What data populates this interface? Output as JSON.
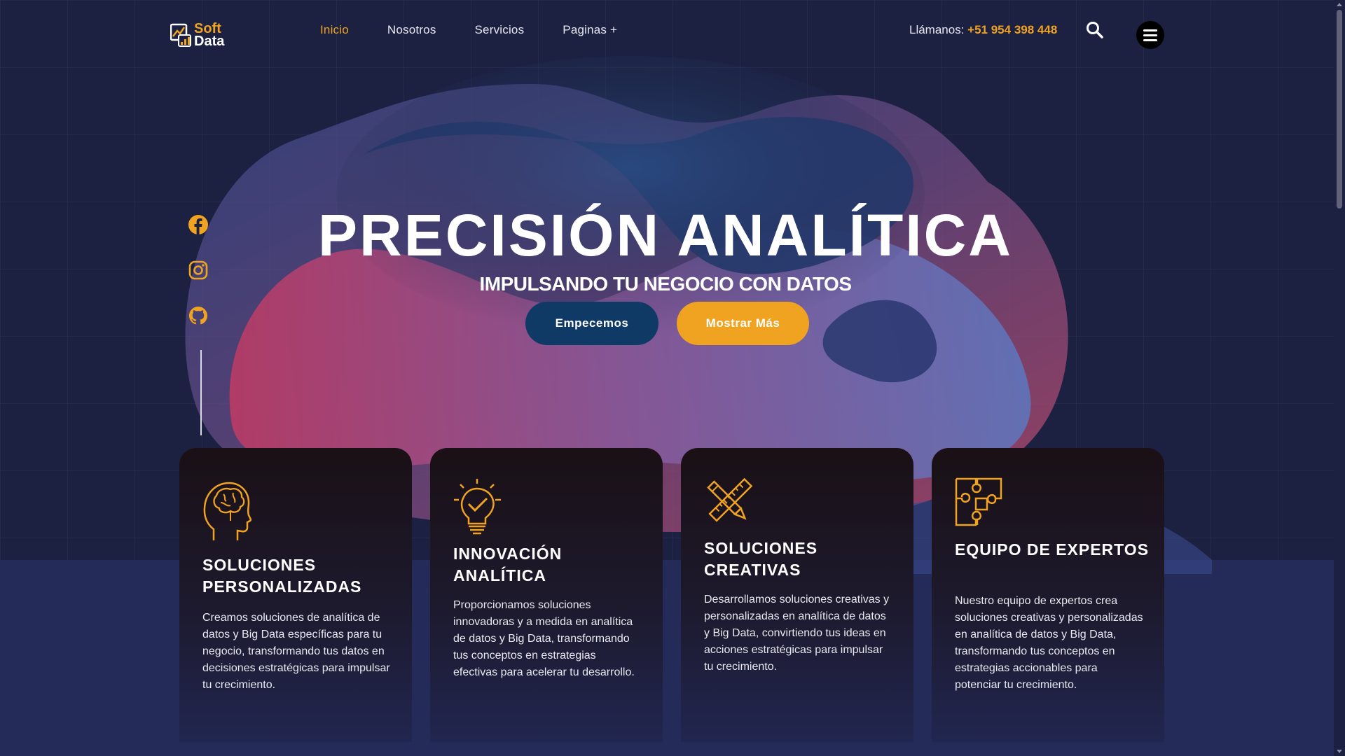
{
  "colors": {
    "accent": "#f0a321",
    "primary_button": "#0f3a66",
    "background": "#1c2142",
    "card_background": "#1a1015"
  },
  "brand": {
    "logo_top": "Soft",
    "logo_bottom": "Data",
    "logo_icon": "chart-window-icon"
  },
  "nav": {
    "items": [
      "Inicio",
      "Nosotros",
      "Servicios",
      "Paginas +"
    ],
    "active": "Inicio"
  },
  "header": {
    "phone_label": "Llámanos: ",
    "phone_number": "+51 954 398 448",
    "search_icon": "search-icon",
    "menu_icon": "hamburger-menu-icon"
  },
  "social": [
    "facebook-icon",
    "instagram-icon",
    "github-icon"
  ],
  "hero": {
    "title": "PRECISIÓN ANALÍTICA",
    "subtitle": "IMPULSANDO TU NEGOCIO CON DATOS",
    "primary_button": "Empecemos",
    "secondary_button": "Mostrar Más"
  },
  "cards": [
    {
      "icon": "brain-head-icon",
      "title": "Soluciones Personalizadas",
      "text": "Creamos soluciones de analítica de datos y Big Data específicas para tu negocio, transformando tus datos en decisiones estratégicas para impulsar tu crecimiento."
    },
    {
      "icon": "lightbulb-check-icon",
      "title": "Innovación Analítica",
      "text": "Proporcionamos soluciones innovadoras y a medida en analítica de datos y Big Data, transformando tus conceptos en estrategias efectivas para acelerar tu desarrollo."
    },
    {
      "icon": "pencil-ruler-icon",
      "title": "Soluciones Creativas",
      "text": "Desarrollamos soluciones creativas y personalizadas en analítica de datos y Big Data, convirtiendo tus ideas en acciones estratégicas para impulsar tu crecimiento."
    },
    {
      "icon": "puzzle-icon",
      "title": "Equipo de Expertos",
      "text": "Nuestro equipo de expertos crea soluciones creativas y personalizadas en analítica de datos y Big Data, transformando tus conceptos en estrategias accionables para potenciar tu crecimiento."
    }
  ]
}
